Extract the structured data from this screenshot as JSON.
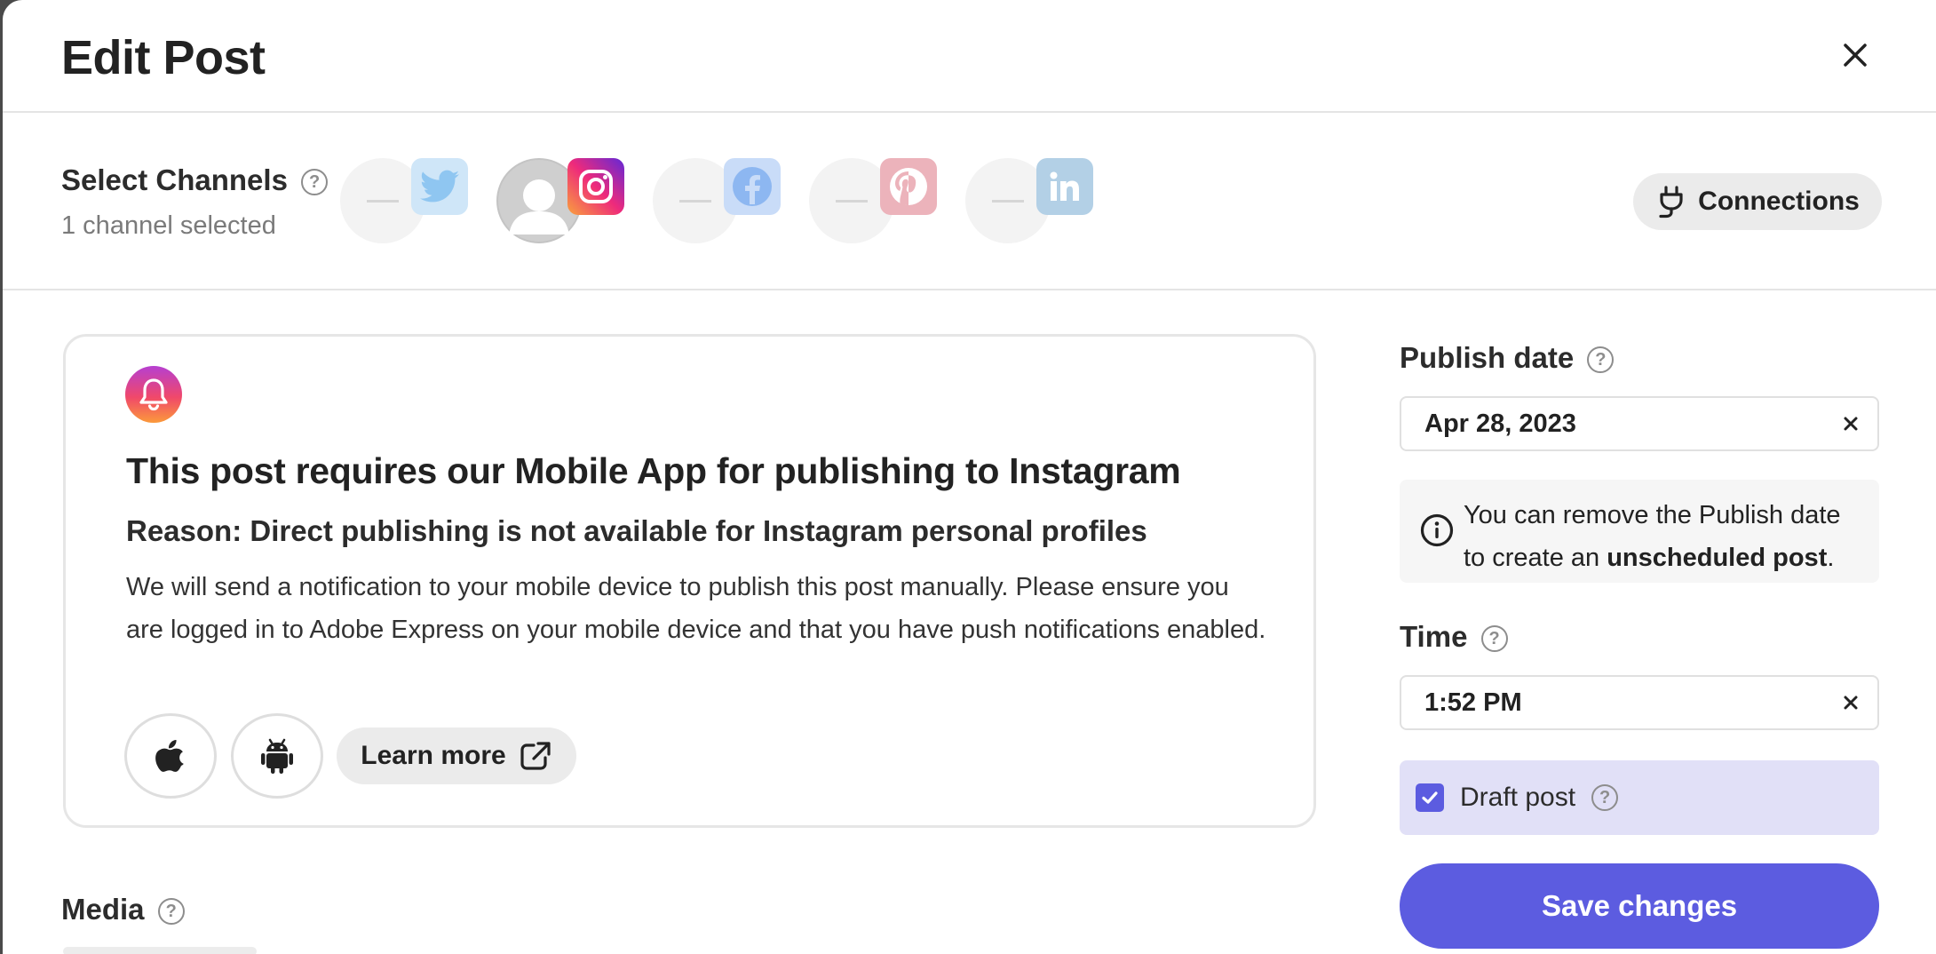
{
  "modal": {
    "title": "Edit Post"
  },
  "channels": {
    "label": "Select Channels",
    "selected_count_text": "1 channel selected",
    "items": [
      {
        "platform": "Twitter",
        "icon": "twitter-icon",
        "selected": false,
        "color": "#1DA1F2"
      },
      {
        "platform": "Instagram",
        "icon": "instagram-icon",
        "selected": true,
        "color": "#E1306C"
      },
      {
        "platform": "Facebook",
        "icon": "facebook-icon",
        "selected": false,
        "color": "#1877F2"
      },
      {
        "platform": "Pinterest",
        "icon": "pinterest-icon",
        "selected": false,
        "color": "#E60023"
      },
      {
        "platform": "LinkedIn",
        "icon": "linkedin-icon",
        "selected": false,
        "color": "#0A66C2"
      }
    ],
    "connections_label": "Connections"
  },
  "notice": {
    "title": "This post requires our Mobile App for publishing to Instagram",
    "reason": "Reason: Direct publishing is not available for Instagram personal profiles",
    "body": "We will send a notification to your mobile device to publish this post manually. Please ensure you are logged in to Adobe Express on your mobile device and that you have push notifications enabled.",
    "learn_more_label": "Learn more"
  },
  "media": {
    "label": "Media"
  },
  "publish": {
    "date_label": "Publish date",
    "date_value": "Apr 28, 2023",
    "info_prefix": "You can remove the Publish date to create an ",
    "info_bold": "unscheduled post",
    "info_suffix": ".",
    "time_label": "Time",
    "time_value": "1:52 PM",
    "draft_label": "Draft post",
    "draft_checked": true,
    "save_label": "Save changes"
  },
  "colors": {
    "accent": "#5C5CE0",
    "draft_background": "#E1E0F7"
  }
}
